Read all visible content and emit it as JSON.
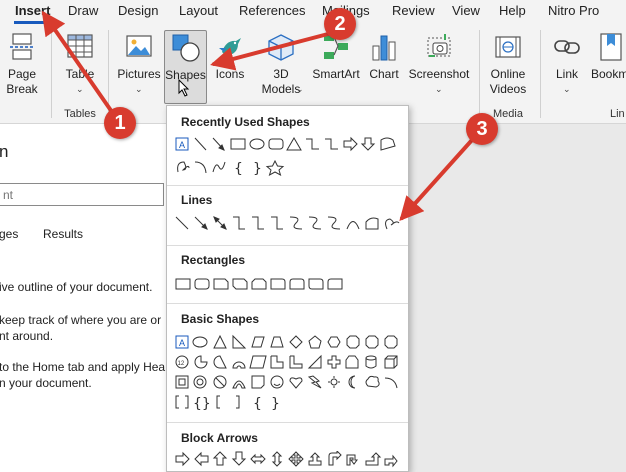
{
  "menu": {
    "items": [
      "Insert",
      "Draw",
      "Design",
      "Layout",
      "References",
      "Mailings",
      "Review",
      "View",
      "Help",
      "Nitro Pro"
    ],
    "active": "Insert",
    "accent": "#185abd"
  },
  "ribbon": {
    "page_break": "Page\nBreak",
    "table": "Table",
    "tables_group": "Tables",
    "pictures": "Pictures",
    "shapes": "Shapes",
    "icons": "Icons",
    "models": "3D\nModels",
    "smartart": "SmartArt",
    "chart": "Chart",
    "screenshot": "Screenshot",
    "online_videos": "Online\nVideos",
    "media_group": "Media",
    "link": "Link",
    "bookmark": "Bookm",
    "links_group": "Lin"
  },
  "navpane": {
    "title_fragment": "n",
    "search_placeholder": "nt",
    "tab_pages": "ges",
    "tab_results": "Results",
    "para1": "ive outline of your document.",
    "para2_line1": " keep track of where you are or",
    "para2_line2": "nt around.",
    "para3_line1": " to the Home tab and apply Hea",
    "para3_line2": "n your document."
  },
  "shapes_panel": {
    "recent": "Recently Used Shapes",
    "lines": "Lines",
    "rectangles": "Rectangles",
    "basic": "Basic Shapes",
    "block_arrows": "Block Arrows"
  },
  "markers": {
    "one": "1",
    "two": "2",
    "three": "3",
    "color": "#d83b2e"
  }
}
